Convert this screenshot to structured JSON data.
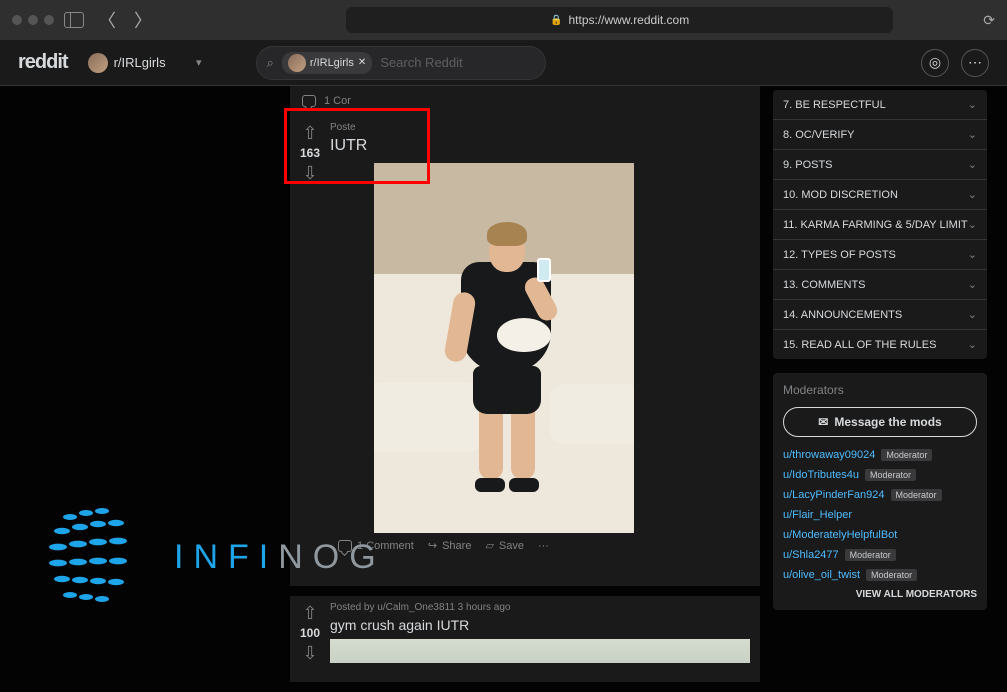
{
  "browser": {
    "url": "https://www.reddit.com"
  },
  "header": {
    "logo": "reddit",
    "community": "r/IRLgirls",
    "search_chip": "r/IRLgirls",
    "search_placeholder": "Search Reddit"
  },
  "post1": {
    "comment_strip": "1 Cor",
    "meta": "Poste",
    "score": "163",
    "title": "IUTR",
    "comments_label": "1 Comment",
    "share_label": "Share",
    "save_label": "Save"
  },
  "post2": {
    "score": "100",
    "meta": "Posted by u/Calm_One3811 3 hours ago",
    "title": "gym crush again IUTR"
  },
  "rules": [
    "7. BE RESPECTFUL",
    "8. OC/VERIFY",
    "9. POSTS",
    "10. MOD DISCRETION",
    "11. KARMA FARMING & 5/DAY LIMIT",
    "12. TYPES OF POSTS",
    "13. COMMENTS",
    "14. ANNOUNCEMENTS",
    "15. READ ALL OF THE RULES"
  ],
  "mods": {
    "title": "Moderators",
    "message_btn": "Message the mods",
    "list": [
      {
        "name": "u/throwaway09024",
        "badge": "Moderator"
      },
      {
        "name": "u/IdoTributes4u",
        "badge": "Moderator"
      },
      {
        "name": "u/LacyPinderFan924",
        "badge": "Moderator"
      },
      {
        "name": "u/Flair_Helper",
        "badge": ""
      },
      {
        "name": "u/ModeratelyHelpfulBot",
        "badge": ""
      },
      {
        "name": "u/Shla2477",
        "badge": "Moderator"
      },
      {
        "name": "u/olive_oil_twist",
        "badge": "Moderator"
      }
    ],
    "view_all": "VIEW ALL MODERATORS"
  },
  "watermark": {
    "t1": "INFI",
    "t2": "NOG"
  }
}
